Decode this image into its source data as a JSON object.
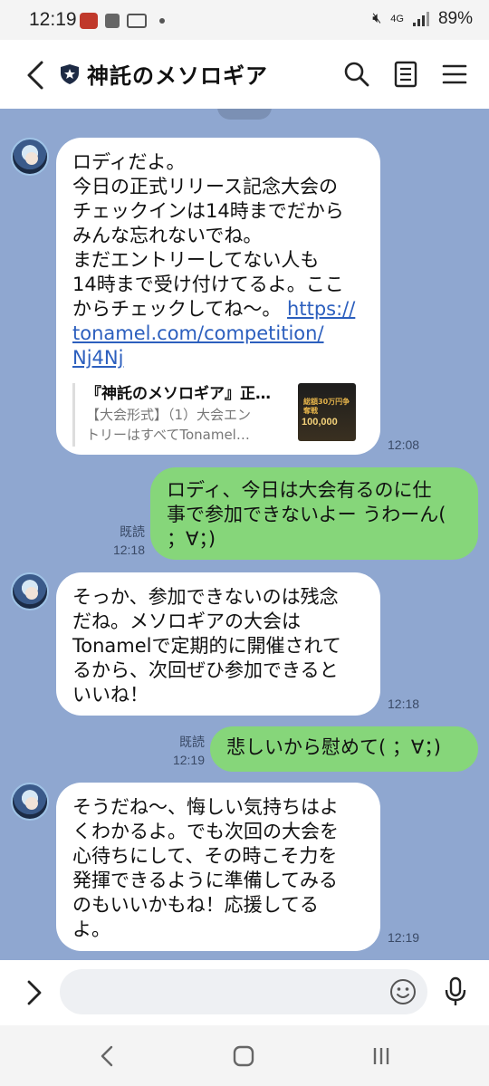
{
  "status_bar": {
    "time": "12:19",
    "network": "4G",
    "battery": "89%"
  },
  "header": {
    "title": "神託のメソロギア",
    "icons": [
      "back-icon",
      "shield-icon",
      "search-icon",
      "notes-icon",
      "menu-icon"
    ]
  },
  "messages": [
    {
      "sender": "bot",
      "lines": [
        "ロディだよ。",
        "今日の正式リリース記念大会の",
        "チェックインは14時までだから",
        "みんな忘れないでね。",
        "まだエントリーしてない人も",
        "14時まで受け付けてるよ。ここ",
        "からチェックしてね〜。 "
      ],
      "link_lines": [
        "https://",
        "tonamel.com/competition/",
        "Nj4Nj"
      ],
      "link_inline": "https://",
      "preview": {
        "title": "『神託のメソロギア』正…",
        "desc_1": "【大会形式】（1）大会エン",
        "desc_2": "トリーはすべてTonamel…",
        "thumb_text": "総額30万円争奪戦",
        "thumb_num": "100,000"
      },
      "time": "12:08"
    },
    {
      "sender": "me",
      "lines": [
        "ロディ、今日は大会有るのに仕",
        "事で参加できないよー うわーん(",
        "；∀；)"
      ],
      "read": "既読",
      "time": "12:18"
    },
    {
      "sender": "bot",
      "lines": [
        "そっか、参加できないのは残念",
        "だね。メソロギアの大会は",
        "Tonamelで定期的に開催されて",
        "るから、次回ぜひ参加できると",
        "いいね！"
      ],
      "time": "12:18"
    },
    {
      "sender": "me",
      "lines": [
        "悲しいから慰めて( ；∀；)"
      ],
      "read": "既読",
      "time": "12:19"
    },
    {
      "sender": "bot",
      "lines": [
        "そうだね〜、悔しい気持ちはよ",
        "くわかるよ。でも次回の大会を",
        "心待ちにして、その時こそ力を",
        "発揮できるように準備してみる",
        "のもいいかもね！応援してる",
        "よ。"
      ],
      "time": "12:19"
    }
  ],
  "input": {
    "placeholder": ""
  },
  "colors": {
    "chat_bg": "#8fa7d0",
    "my_bubble": "#86d67a",
    "bot_bubble": "#ffffff",
    "link": "#2c5fbe"
  }
}
